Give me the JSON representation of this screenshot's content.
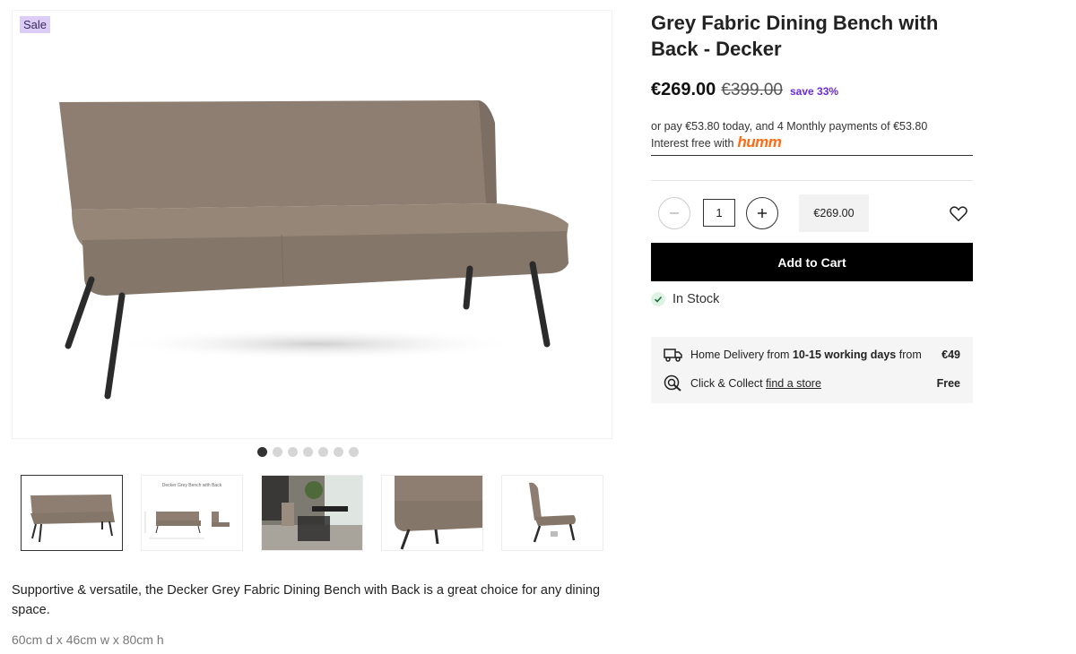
{
  "gallery": {
    "badge": "Sale",
    "dots_count": 7,
    "active_dot": 0,
    "thumb_caption": "Decker Grey Bench with Back"
  },
  "product": {
    "title": "Grey Fabric Dining Bench with Back - Decker",
    "price": "€269.00",
    "old_price": "€399.00",
    "save": "save 33%",
    "finance_line": "or pay €53.80 today, and 4 Monthly payments of €53.80",
    "finance_interest": "Interest free with",
    "finance_brand": "humm",
    "quantity": "1",
    "line_total": "€269.00",
    "add_to_cart": "Add to Cart",
    "stock_status": "In Stock",
    "description": "Supportive & versatile, the Decker Grey Fabric Dining Bench with Back is a great choice for any dining space.",
    "dimensions": "60cm d x 46cm w x 80cm h"
  },
  "delivery": {
    "home_prefix": "Home Delivery from",
    "home_days": "10-15 working days",
    "home_suffix": "from",
    "home_price": "€49",
    "collect_prefix": "Click & Collect",
    "collect_link": "find a store",
    "collect_price": "Free"
  },
  "icons": {
    "minus": "minus-icon",
    "plus": "plus-icon",
    "wishlist": "heart-icon",
    "stock": "check-icon",
    "home_delivery": "truck-icon",
    "click_collect": "click-collect-icon"
  },
  "colors": {
    "sale_badge": "#dccdf6",
    "save_text": "#6a2bd9",
    "brand_humm": "#ff6a13",
    "cart_button": "#000000"
  }
}
